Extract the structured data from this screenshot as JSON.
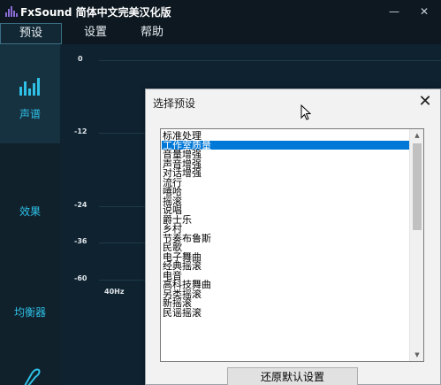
{
  "app": {
    "title": "FxSound 简体中文完美汉化版",
    "minimize_glyph": "—",
    "close_glyph": "✕"
  },
  "menu": {
    "items": [
      {
        "label": "预设",
        "active": true
      },
      {
        "label": "设置",
        "active": false
      },
      {
        "label": "帮助",
        "active": false
      }
    ]
  },
  "sidebar": {
    "items": [
      {
        "label": "声谱",
        "icon": "equalizer-bars-icon",
        "active": true
      },
      {
        "label": "效果",
        "icon": "",
        "active": false
      },
      {
        "label": "均衡器",
        "icon": "",
        "active": false
      },
      {
        "label": "",
        "icon": "rocket-icon",
        "active": false
      }
    ]
  },
  "graph": {
    "y_labels": [
      "0",
      "-12",
      "-24",
      "-36",
      "-60"
    ],
    "x_labels": [
      "40Hz"
    ]
  },
  "dialog": {
    "title": "选择预设",
    "close_glyph": "✕",
    "presets": [
      "标准处理",
      "工作室质量",
      "音量增强",
      "声音增强",
      "对话增强",
      "流行",
      "嘻哈",
      "摇滚",
      "说唱",
      "爵士乐",
      "乡村",
      "节奏布鲁斯",
      "民歌",
      "电子舞曲",
      "经典摇滚",
      "电音",
      "高科技舞曲",
      "另类摇滚",
      "新摇滚",
      "民谣摇滚"
    ],
    "selected_index": 1,
    "reset_button": "还原默认设置"
  },
  "colors": {
    "accent": "#2ec0e6",
    "logo": "#8a6cd6",
    "selection": "#0078d7"
  }
}
